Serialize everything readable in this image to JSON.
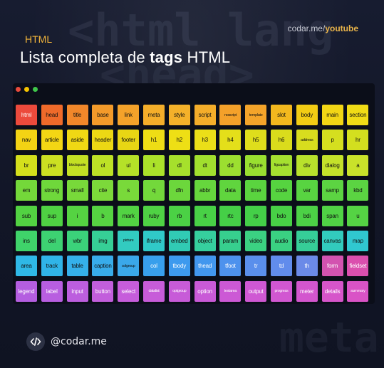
{
  "header": {
    "kicker": "HTML",
    "title_prefix": "Lista completa de ",
    "title_bold": "tags",
    "title_suffix": " HTML",
    "source_site": "codar.me/",
    "source_channel": "youtube"
  },
  "background_code": {
    "line1": "<html lang",
    "line2": "<head>",
    "line3": "meta"
  },
  "window_dots": [
    "#e94b3c",
    "#f5c400",
    "#3fc64a"
  ],
  "rows": [
    {
      "color": "#f1c40f",
      "tags": [
        "html",
        "head",
        "title",
        "base",
        "link",
        "meta",
        "style",
        "script",
        "noscript",
        "template",
        "slot",
        "body",
        "main",
        "section"
      ]
    },
    {
      "color": "#f0dd1c",
      "tags": [
        "nav",
        "article",
        "aside",
        "header",
        "footer",
        "h1",
        "h2",
        "h3",
        "h4",
        "h5",
        "h6",
        "address",
        "p",
        "hr"
      ]
    },
    {
      "color": "#bfe12a",
      "tags": [
        "br",
        "pre",
        "blockquote",
        "ol",
        "ul",
        "li",
        "dl",
        "dt",
        "dd",
        "figure",
        "figcaption",
        "div",
        "dialog",
        "a"
      ]
    },
    {
      "color": "#74d83a",
      "tags": [
        "em",
        "strong",
        "small",
        "cite",
        "s",
        "q",
        "dfn",
        "abbr",
        "data",
        "time",
        "code",
        "var",
        "samp",
        "kbd"
      ]
    },
    {
      "color": "#52d242",
      "tags": [
        "sub",
        "sup",
        "i",
        "b",
        "mark",
        "ruby",
        "rb",
        "rt",
        "rtc",
        "rp",
        "bdo",
        "bdi",
        "span",
        "u"
      ]
    },
    {
      "color": "#38d37a",
      "tags": [
        "ins",
        "del",
        "wbr",
        "img",
        "picture",
        "iframe",
        "embed",
        "object",
        "param",
        "video",
        "audio",
        "source",
        "canvas",
        "map"
      ]
    },
    {
      "color": "#2fb8e6",
      "tags": [
        "area",
        "track",
        "table",
        "caption",
        "colgroup",
        "col",
        "tbody",
        "thead",
        "tfoot",
        "tr",
        "td",
        "th",
        "form",
        "fieldset"
      ]
    },
    {
      "color": "#b45ee0",
      "tags": [
        "legend",
        "label",
        "input",
        "button",
        "select",
        "datalist",
        "optgroup",
        "option",
        "textarea",
        "output",
        "progress",
        "meter",
        "details",
        "summary"
      ]
    }
  ],
  "tag_colors": {
    "html": "#ec4a3c",
    "head": "#f06a2a",
    "title": "#f2872a",
    "base": "#f39a2a",
    "link": "#f4a22a",
    "meta": "#f4ae2a",
    "style": "#f4b12a",
    "script": "#f4ad2a",
    "noscript": "#f4a12a",
    "template": "#f4a42a",
    "slot": "#f3b81e",
    "body": "#f2cc14",
    "main": "#f2d615",
    "section": "#f0dc16",
    "nav": "#f3d314",
    "article": "#f3d614",
    "aside": "#f0d814",
    "header": "#ecd814",
    "footer": "#e8d614",
    "h1": "#eedd15",
    "h2": "#eedf15",
    "h3": "#ebdf18",
    "h4": "#e4df1a",
    "h5": "#dfde1c",
    "h6": "#dadc1c",
    "address": "#d8dd1e",
    "p": "#d5df1f",
    "hr": "#d3df1f",
    "br": "#d4df1c",
    "pre": "#cce022",
    "blockquote": "#c3e024",
    "ol": "#bde126",
    "ul": "#b5e128",
    "li": "#abe12a",
    "dl": "#a6e02c",
    "dt": "#a1df2e",
    "dd": "#9cdf30",
    "figure": "#99df30",
    "figcaption": "#a5e030",
    "div": "#b8e12c",
    "dialog": "#c4e22a",
    "a": "#c9e22a",
    "em": "#74d83a",
    "strong": "#6fd83b",
    "small": "#78d93a",
    "cite": "#7cd93a",
    "s": "#79d93a",
    "q": "#73d83b",
    "dfn": "#6cd73c",
    "abbr": "#66d63d",
    "data": "#60d53e",
    "time": "#5ad43f",
    "code": "#56d440",
    "var": "#58d441",
    "samp": "#5cd442",
    "kbd": "#5bd442",
    "sub": "#52d242",
    "sup": "#4fd243",
    "i": "#55d342",
    "b": "#56d342",
    "mark": "#52d343",
    "ruby": "#4fd244",
    "rb": "#4bd145",
    "rt": "#48d046",
    "rtc": "#45cf47",
    "rp": "#44cf48",
    "bdo": "#48d046",
    "bdi": "#4cd146",
    "span": "#50d245",
    "u": "#55d344",
    "ins": "#3fd36a",
    "del": "#3dd272",
    "wbr": "#3bd27a",
    "img": "#36cf96",
    "picture": "#32cbc0",
    "iframe": "#30c9c8",
    "embed": "#31cbb4",
    "object": "#36cf9e",
    "param": "#37cf8e",
    "video": "#3bd182",
    "audio": "#3ad182",
    "source": "#36ce98",
    "canvas": "#32cbbd",
    "map": "#30c8d0",
    "area": "#2fb8e6",
    "track": "#30b4e8",
    "table": "#35b0ea",
    "caption": "#38acea",
    "colgroup": "#3aa8ea",
    "col": "#389fec",
    "tbody": "#3d9aee",
    "thead": "#4297ee",
    "tfoot": "#4d92ed",
    "tr": "#5a8fec",
    "td": "#618cec",
    "th": "#6b8ae8",
    "form": "#d353b0",
    "fieldset": "#db4fae",
    "legend": "#b45ee0",
    "label": "#b85ee0",
    "input": "#bc5ede",
    "button": "#c25edc",
    "select": "#c65ddb",
    "datalist": "#c75cd9",
    "optgroup": "#c75bd8",
    "option": "#c95ad7",
    "textarea": "#cc59d5",
    "output": "#cf58d3",
    "progress": "#d157d1",
    "meter": "#d356ce",
    "details": "#d655ca",
    "summary": "#d953c6"
  },
  "small_tags": [
    "noscript",
    "template",
    "blockquote",
    "figcaption",
    "address",
    "picture",
    "colgroup",
    "datalist",
    "optgroup",
    "textarea",
    "progress",
    "summary"
  ],
  "dark_text_tags": [
    "html",
    "legend",
    "label",
    "input",
    "button",
    "select",
    "datalist",
    "optgroup",
    "option",
    "textarea",
    "output",
    "progress",
    "meter",
    "details",
    "summary",
    "form",
    "fieldset",
    "tbody",
    "thead",
    "tfoot",
    "tr",
    "td",
    "th",
    "col"
  ],
  "footer": {
    "handle": "@codar.me"
  }
}
